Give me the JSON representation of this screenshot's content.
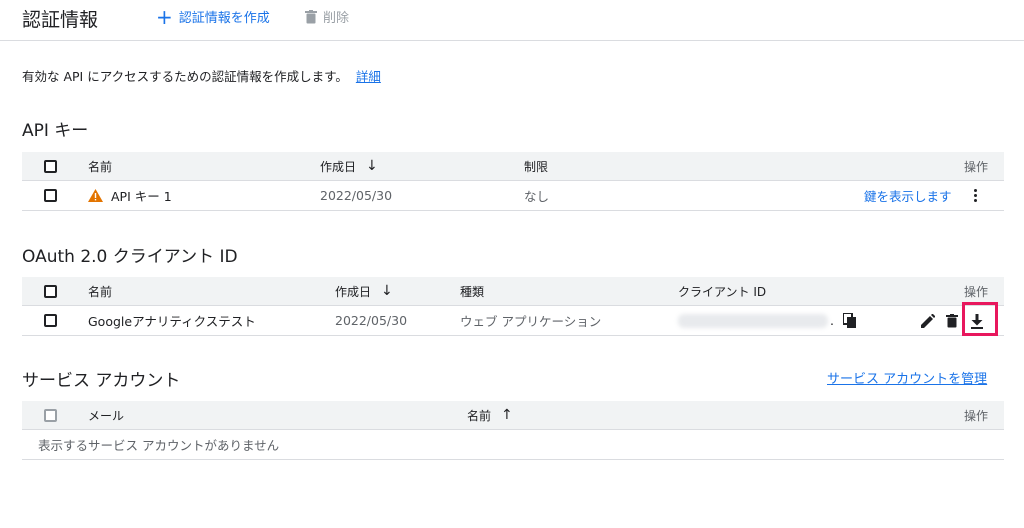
{
  "header": {
    "title": "認証情報",
    "create_label": "認証情報を作成",
    "delete_label": "削除"
  },
  "intro": {
    "text": "有効な API にアクセスするための認証情報を作成します。",
    "link": "詳細"
  },
  "api_keys": {
    "title": "API キー",
    "columns": {
      "name": "名前",
      "created": "作成日",
      "restriction": "制限",
      "actions": "操作"
    },
    "rows": [
      {
        "name": "API キー 1",
        "created": "2022/05/30",
        "restriction": "なし",
        "show_key": "鍵を表示します"
      }
    ]
  },
  "oauth": {
    "title": "OAuth 2.0 クライアント ID",
    "columns": {
      "name": "名前",
      "created": "作成日",
      "type": "種類",
      "client_id": "クライアント ID",
      "actions": "操作"
    },
    "rows": [
      {
        "name": "Googleアナリティクステスト",
        "created": "2022/05/30",
        "type": "ウェブ アプリケーション",
        "client_id_suffix": "."
      }
    ]
  },
  "service_accounts": {
    "title": "サービス アカウント",
    "manage_link": "サービス アカウントを管理",
    "columns": {
      "email": "メール",
      "name": "名前",
      "actions": "操作"
    },
    "empty_text": "表示するサービス アカウントがありません"
  },
  "colors": {
    "accent": "#1a73e8",
    "warning": "#e37400",
    "highlight": "#e8175d"
  },
  "icons": [
    "plus-icon",
    "trash-icon",
    "sort-arrow-icon",
    "warning-icon",
    "more-vert-icon",
    "copy-icon",
    "edit-icon",
    "download-icon"
  ]
}
